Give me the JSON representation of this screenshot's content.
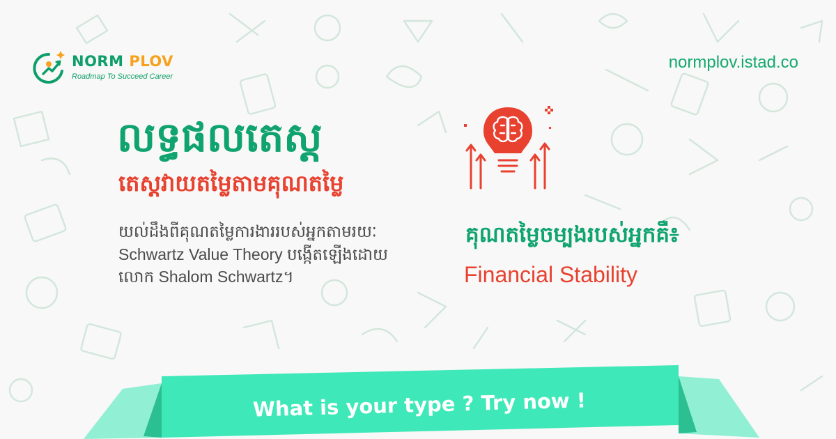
{
  "brand": {
    "name_part1": "NORM ",
    "name_part2": "PLOV",
    "tagline": "Roadmap To Succeed Career",
    "site_url": "normplov.istad.co"
  },
  "hero": {
    "title": "លទ្ធផលតេស្ត",
    "subtitle": "តេស្តវាយតម្លៃតាមគុណតម្លៃ",
    "description": "យល់ដឹងពីគុណតម្លៃការងាររបស់អ្នកតាមរយៈ Schwartz Value Theory បង្កើតឡើងដោយលោក Shalom Schwartz។"
  },
  "result": {
    "icon": "lightbulb-brain-icon",
    "label": "គុណតម្លៃចម្បងរបស់អ្នកគឺ៖",
    "value": "Financial Stability"
  },
  "cta": {
    "label": "What is your type ? Try now !"
  },
  "colors": {
    "brand_green": "#0fa36f",
    "accent_red": "#e8412f",
    "banner_green": "#3ee8b8",
    "banner_fold": "#2bbf92",
    "logo_orange": "#f6a21e",
    "pattern": "#cfe4d9"
  }
}
